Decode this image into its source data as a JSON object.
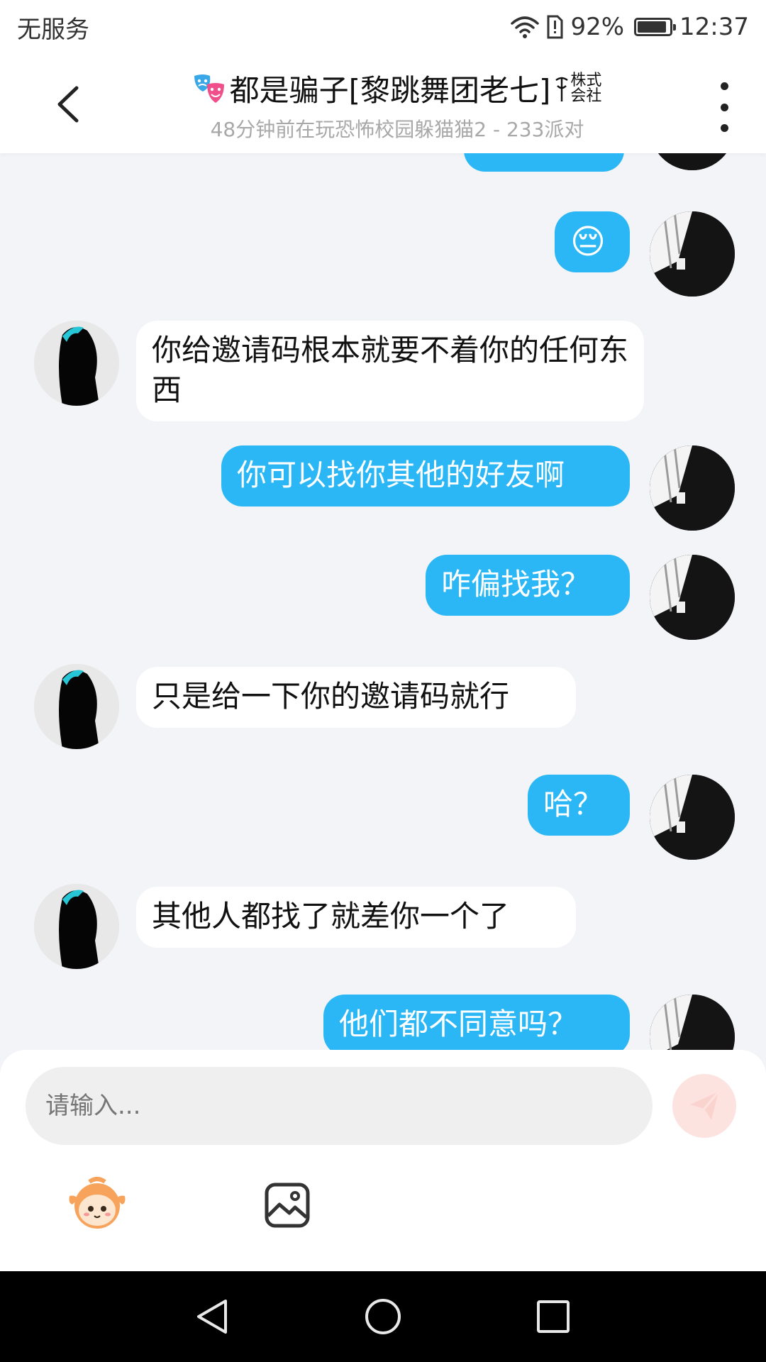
{
  "status_bar": {
    "carrier": "无服务",
    "battery": "92%",
    "battery_level": 0.92,
    "time": "12:37"
  },
  "header": {
    "title": "都是骗子[黎跳舞团老七]",
    "badge_line1": "株式",
    "badge_line2": "会社",
    "subtitle": "48分钟前在玩恐怖校园躲猫猫2 - 233派对"
  },
  "messages": [
    {
      "side": "right",
      "text": "😔"
    },
    {
      "side": "left",
      "text": "你给邀请码根本就要不着你的任何东西"
    },
    {
      "side": "right",
      "text": "你可以找你其他的好友啊"
    },
    {
      "side": "right",
      "text": "咋偏找我？"
    },
    {
      "side": "left",
      "text": "只是给一下你的邀请码就行"
    },
    {
      "side": "right",
      "text": "哈？"
    },
    {
      "side": "left",
      "text": "其他人都找了就差你一个了"
    },
    {
      "side": "right",
      "text": "他们都不同意吗？"
    }
  ],
  "input": {
    "placeholder": "请输入..."
  },
  "colors": {
    "accent": "#2bb7f5",
    "background": "#f2f4f7",
    "send_button": "#fde3e0"
  },
  "icons": [
    "back-icon",
    "more-icon",
    "mask-icon",
    "send-icon",
    "emoji-icon",
    "image-icon",
    "nav-back-icon",
    "nav-home-icon",
    "nav-recents-icon"
  ]
}
